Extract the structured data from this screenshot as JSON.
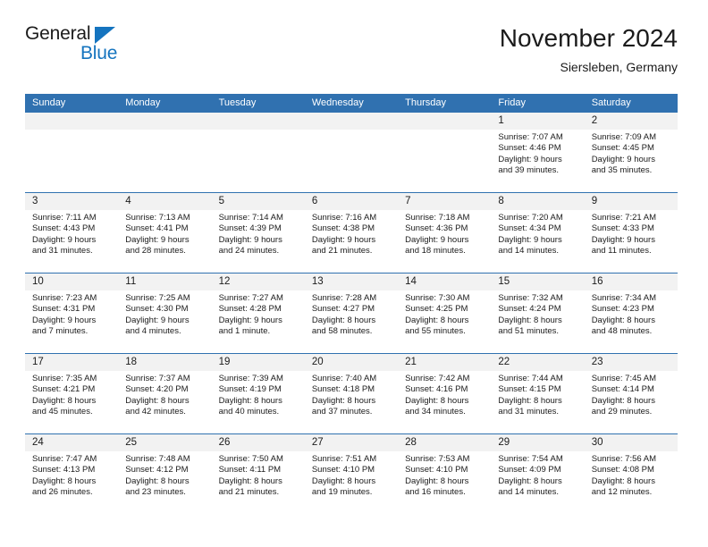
{
  "brand": {
    "name_part1": "General",
    "name_part2": "Blue",
    "accent_color": "#1574bf",
    "triangle_icon": "triangle-icon"
  },
  "header": {
    "title": "November 2024",
    "subtitle": "Siersleben, Germany",
    "header_bg_color": "#3071b0",
    "daynum_bg_color": "#f2f2f2"
  },
  "weekdays": [
    "Sunday",
    "Monday",
    "Tuesday",
    "Wednesday",
    "Thursday",
    "Friday",
    "Saturday"
  ],
  "calendar": {
    "month": "November",
    "year": "2024",
    "location": "Siersleben, Germany",
    "weeks": [
      [
        {
          "day": "",
          "sunrise": "",
          "sunset": "",
          "daylight1": "",
          "daylight2": ""
        },
        {
          "day": "",
          "sunrise": "",
          "sunset": "",
          "daylight1": "",
          "daylight2": ""
        },
        {
          "day": "",
          "sunrise": "",
          "sunset": "",
          "daylight1": "",
          "daylight2": ""
        },
        {
          "day": "",
          "sunrise": "",
          "sunset": "",
          "daylight1": "",
          "daylight2": ""
        },
        {
          "day": "",
          "sunrise": "",
          "sunset": "",
          "daylight1": "",
          "daylight2": ""
        },
        {
          "day": "1",
          "sunrise": "Sunrise: 7:07 AM",
          "sunset": "Sunset: 4:46 PM",
          "daylight1": "Daylight: 9 hours",
          "daylight2": "and 39 minutes."
        },
        {
          "day": "2",
          "sunrise": "Sunrise: 7:09 AM",
          "sunset": "Sunset: 4:45 PM",
          "daylight1": "Daylight: 9 hours",
          "daylight2": "and 35 minutes."
        }
      ],
      [
        {
          "day": "3",
          "sunrise": "Sunrise: 7:11 AM",
          "sunset": "Sunset: 4:43 PM",
          "daylight1": "Daylight: 9 hours",
          "daylight2": "and 31 minutes."
        },
        {
          "day": "4",
          "sunrise": "Sunrise: 7:13 AM",
          "sunset": "Sunset: 4:41 PM",
          "daylight1": "Daylight: 9 hours",
          "daylight2": "and 28 minutes."
        },
        {
          "day": "5",
          "sunrise": "Sunrise: 7:14 AM",
          "sunset": "Sunset: 4:39 PM",
          "daylight1": "Daylight: 9 hours",
          "daylight2": "and 24 minutes."
        },
        {
          "day": "6",
          "sunrise": "Sunrise: 7:16 AM",
          "sunset": "Sunset: 4:38 PM",
          "daylight1": "Daylight: 9 hours",
          "daylight2": "and 21 minutes."
        },
        {
          "day": "7",
          "sunrise": "Sunrise: 7:18 AM",
          "sunset": "Sunset: 4:36 PM",
          "daylight1": "Daylight: 9 hours",
          "daylight2": "and 18 minutes."
        },
        {
          "day": "8",
          "sunrise": "Sunrise: 7:20 AM",
          "sunset": "Sunset: 4:34 PM",
          "daylight1": "Daylight: 9 hours",
          "daylight2": "and 14 minutes."
        },
        {
          "day": "9",
          "sunrise": "Sunrise: 7:21 AM",
          "sunset": "Sunset: 4:33 PM",
          "daylight1": "Daylight: 9 hours",
          "daylight2": "and 11 minutes."
        }
      ],
      [
        {
          "day": "10",
          "sunrise": "Sunrise: 7:23 AM",
          "sunset": "Sunset: 4:31 PM",
          "daylight1": "Daylight: 9 hours",
          "daylight2": "and 7 minutes."
        },
        {
          "day": "11",
          "sunrise": "Sunrise: 7:25 AM",
          "sunset": "Sunset: 4:30 PM",
          "daylight1": "Daylight: 9 hours",
          "daylight2": "and 4 minutes."
        },
        {
          "day": "12",
          "sunrise": "Sunrise: 7:27 AM",
          "sunset": "Sunset: 4:28 PM",
          "daylight1": "Daylight: 9 hours",
          "daylight2": "and 1 minute."
        },
        {
          "day": "13",
          "sunrise": "Sunrise: 7:28 AM",
          "sunset": "Sunset: 4:27 PM",
          "daylight1": "Daylight: 8 hours",
          "daylight2": "and 58 minutes."
        },
        {
          "day": "14",
          "sunrise": "Sunrise: 7:30 AM",
          "sunset": "Sunset: 4:25 PM",
          "daylight1": "Daylight: 8 hours",
          "daylight2": "and 55 minutes."
        },
        {
          "day": "15",
          "sunrise": "Sunrise: 7:32 AM",
          "sunset": "Sunset: 4:24 PM",
          "daylight1": "Daylight: 8 hours",
          "daylight2": "and 51 minutes."
        },
        {
          "day": "16",
          "sunrise": "Sunrise: 7:34 AM",
          "sunset": "Sunset: 4:23 PM",
          "daylight1": "Daylight: 8 hours",
          "daylight2": "and 48 minutes."
        }
      ],
      [
        {
          "day": "17",
          "sunrise": "Sunrise: 7:35 AM",
          "sunset": "Sunset: 4:21 PM",
          "daylight1": "Daylight: 8 hours",
          "daylight2": "and 45 minutes."
        },
        {
          "day": "18",
          "sunrise": "Sunrise: 7:37 AM",
          "sunset": "Sunset: 4:20 PM",
          "daylight1": "Daylight: 8 hours",
          "daylight2": "and 42 minutes."
        },
        {
          "day": "19",
          "sunrise": "Sunrise: 7:39 AM",
          "sunset": "Sunset: 4:19 PM",
          "daylight1": "Daylight: 8 hours",
          "daylight2": "and 40 minutes."
        },
        {
          "day": "20",
          "sunrise": "Sunrise: 7:40 AM",
          "sunset": "Sunset: 4:18 PM",
          "daylight1": "Daylight: 8 hours",
          "daylight2": "and 37 minutes."
        },
        {
          "day": "21",
          "sunrise": "Sunrise: 7:42 AM",
          "sunset": "Sunset: 4:16 PM",
          "daylight1": "Daylight: 8 hours",
          "daylight2": "and 34 minutes."
        },
        {
          "day": "22",
          "sunrise": "Sunrise: 7:44 AM",
          "sunset": "Sunset: 4:15 PM",
          "daylight1": "Daylight: 8 hours",
          "daylight2": "and 31 minutes."
        },
        {
          "day": "23",
          "sunrise": "Sunrise: 7:45 AM",
          "sunset": "Sunset: 4:14 PM",
          "daylight1": "Daylight: 8 hours",
          "daylight2": "and 29 minutes."
        }
      ],
      [
        {
          "day": "24",
          "sunrise": "Sunrise: 7:47 AM",
          "sunset": "Sunset: 4:13 PM",
          "daylight1": "Daylight: 8 hours",
          "daylight2": "and 26 minutes."
        },
        {
          "day": "25",
          "sunrise": "Sunrise: 7:48 AM",
          "sunset": "Sunset: 4:12 PM",
          "daylight1": "Daylight: 8 hours",
          "daylight2": "and 23 minutes."
        },
        {
          "day": "26",
          "sunrise": "Sunrise: 7:50 AM",
          "sunset": "Sunset: 4:11 PM",
          "daylight1": "Daylight: 8 hours",
          "daylight2": "and 21 minutes."
        },
        {
          "day": "27",
          "sunrise": "Sunrise: 7:51 AM",
          "sunset": "Sunset: 4:10 PM",
          "daylight1": "Daylight: 8 hours",
          "daylight2": "and 19 minutes."
        },
        {
          "day": "28",
          "sunrise": "Sunrise: 7:53 AM",
          "sunset": "Sunset: 4:10 PM",
          "daylight1": "Daylight: 8 hours",
          "daylight2": "and 16 minutes."
        },
        {
          "day": "29",
          "sunrise": "Sunrise: 7:54 AM",
          "sunset": "Sunset: 4:09 PM",
          "daylight1": "Daylight: 8 hours",
          "daylight2": "and 14 minutes."
        },
        {
          "day": "30",
          "sunrise": "Sunrise: 7:56 AM",
          "sunset": "Sunset: 4:08 PM",
          "daylight1": "Daylight: 8 hours",
          "daylight2": "and 12 minutes."
        }
      ]
    ]
  }
}
